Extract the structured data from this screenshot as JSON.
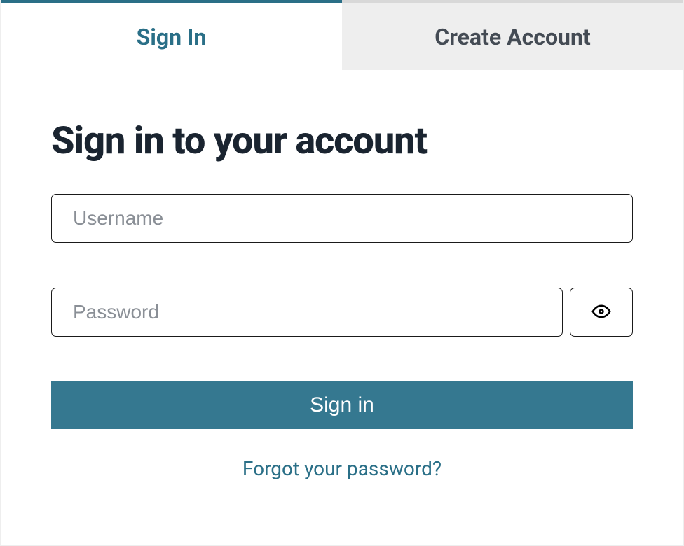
{
  "tabs": {
    "signin": "Sign In",
    "create": "Create Account"
  },
  "heading": "Sign in to your account",
  "fields": {
    "username_placeholder": "Username",
    "password_placeholder": "Password"
  },
  "buttons": {
    "submit": "Sign in"
  },
  "links": {
    "forgot": "Forgot your password?"
  },
  "colors": {
    "accent": "#2a6f87",
    "button_bg": "#357890"
  }
}
